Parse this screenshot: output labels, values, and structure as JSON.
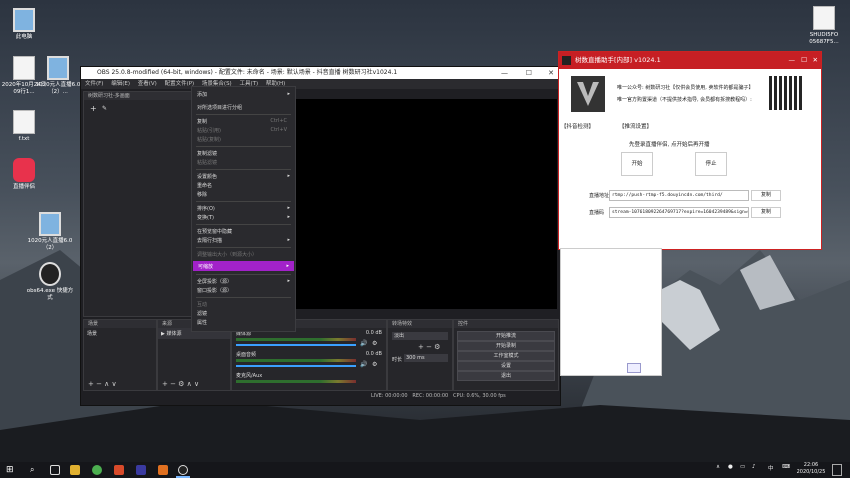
{
  "desktop": {
    "icons": [
      {
        "label": "此电脑"
      },
      {
        "label": "2020年10月24日09行1..."
      },
      {
        "label": "1020元人直播6.0（2）..."
      },
      {
        "label": "f.txt"
      },
      {
        "label": "直播伴侣"
      },
      {
        "label": "1020元人直播6.0（2）"
      },
      {
        "label": "obs64.exe 快捷方式"
      },
      {
        "label": "SHUDI5FO 05687F5..."
      }
    ]
  },
  "obs": {
    "title": "OBS 25.0.8-modified (64-bit, windows) - 配置文件: 未命名 - 场景: 默认场景 - 抖音直播 树数研习社v1024.1",
    "menu": [
      "文件(F)",
      "编辑(E)",
      "查看(V)",
      "配置文件(P)",
      "场景集合(S)",
      "工具(T)",
      "帮助(H)"
    ],
    "source_dock_title": "树数研习社-多画面",
    "docks": {
      "scenes": "场景",
      "sources": "来源",
      "mixer": "音频混音器",
      "transitions": "转场特效",
      "controls": "控件"
    },
    "scene_item": "场景",
    "source_item": "媒体源",
    "mixer_tracks": [
      {
        "name": "媒体源",
        "db": "0.0 dB"
      },
      {
        "name": "桌面音频",
        "db": "0.0 dB"
      },
      {
        "name": "麦克风/Aux",
        "db": ""
      }
    ],
    "transition": {
      "type": "淡出",
      "duration_label": "时长",
      "duration_value": "300 ms"
    },
    "controls": [
      "开始推流",
      "开始录制",
      "工作室模式",
      "设置",
      "退出"
    ],
    "status": {
      "live": "LIVE: 00:00:00",
      "rec": "REC: 00:00:00",
      "cpu": "CPU: 0.6%, 30.00 fps"
    }
  },
  "context_menu": {
    "items": [
      {
        "label": "添加",
        "shortcut": "",
        "submenu": true,
        "disabled": false
      },
      {
        "label": "对所选项目进行分组",
        "shortcut": "",
        "submenu": false,
        "disabled": false
      },
      {
        "label": "复制",
        "shortcut": "Ctrl+C",
        "submenu": false,
        "disabled": false
      },
      {
        "label": "粘贴(引用)",
        "shortcut": "Ctrl+V",
        "submenu": false,
        "disabled": true
      },
      {
        "label": "粘贴(复制)",
        "shortcut": "",
        "submenu": false,
        "disabled": true
      },
      {
        "label": "复制滤镜",
        "shortcut": "",
        "submenu": false,
        "disabled": false
      },
      {
        "label": "粘贴滤镜",
        "shortcut": "",
        "submenu": false,
        "disabled": true
      },
      {
        "label": "设置颜色",
        "shortcut": "",
        "submenu": true,
        "disabled": false
      },
      {
        "label": "重命名",
        "shortcut": "",
        "submenu": false,
        "disabled": false
      },
      {
        "label": "移除",
        "shortcut": "",
        "submenu": false,
        "disabled": false
      },
      {
        "label": "排序(O)",
        "shortcut": "",
        "submenu": true,
        "disabled": false
      },
      {
        "label": "变换(T)",
        "shortcut": "",
        "submenu": true,
        "disabled": false
      },
      {
        "label": "在预览窗中隐藏",
        "shortcut": "",
        "submenu": false,
        "disabled": false
      },
      {
        "label": "去隔行扫描",
        "shortcut": "",
        "submenu": true,
        "disabled": false
      },
      {
        "label": "调整输出大小（到源大小）",
        "shortcut": "",
        "submenu": false,
        "disabled": true
      },
      {
        "label": "可缩放",
        "shortcut": "",
        "submenu": true,
        "disabled": false
      },
      {
        "label": "全屏投影（源）",
        "shortcut": "",
        "submenu": true,
        "disabled": false
      },
      {
        "label": "窗口投影（源）",
        "shortcut": "",
        "submenu": false,
        "disabled": false
      },
      {
        "label": "互动",
        "shortcut": "",
        "submenu": false,
        "disabled": true
      },
      {
        "label": "滤镜",
        "shortcut": "",
        "submenu": false,
        "disabled": false
      },
      {
        "label": "属性",
        "shortcut": "",
        "submenu": false,
        "disabled": false
      }
    ]
  },
  "helper": {
    "title": "树数直播助手[内部] v1024.1",
    "line1": "唯一公众号: 树数研习社【仅供会员使用, 卖软件的都是骗子】",
    "line2": "唯一官方购置渠道（不提供技术指导, 会员都有拆搜教程吗）:",
    "tab1": "【抖音检测】",
    "tab2": "【推流设置】",
    "instruction": "先登录直播伴侣, 点开始后再开播",
    "start": "开始",
    "stop": "停止",
    "addr_label": "直播地址",
    "addr_value": "rtmp://push-rtmp-f5.douyincdn.com/third/",
    "code_label": "直播码",
    "code_value": "stream-107618092264769717?expire=1604239489&sign=0",
    "copy": "复制"
  },
  "taskbar": {
    "time": "22:06",
    "date": "2020/10/25",
    "ime": "中"
  },
  "colors": {
    "helper_title": "#c61f24",
    "menu_highlight": "#a222c9"
  }
}
